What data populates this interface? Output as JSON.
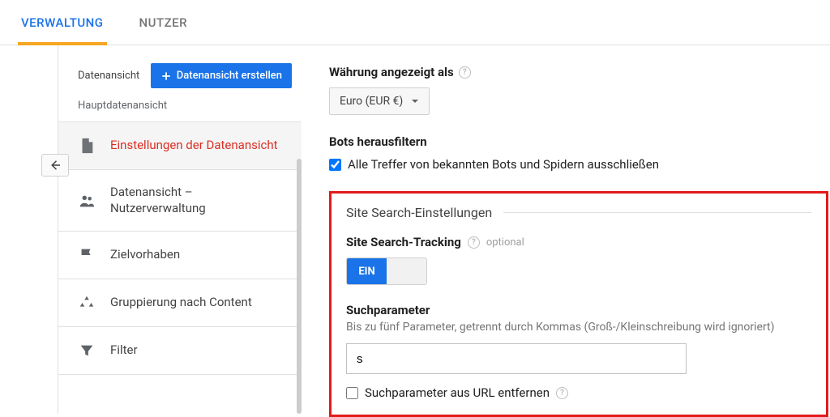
{
  "tabs": {
    "admin": "VERWALTUNG",
    "users": "NUTZER"
  },
  "sidebar": {
    "view_label": "Datenansicht",
    "create_button": "Datenansicht erstellen",
    "main_view_label": "Hauptdatenansicht",
    "items": [
      {
        "label": "Einstellungen der Datenansicht"
      },
      {
        "label": "Datenansicht – Nutzerverwaltung"
      },
      {
        "label": "Zielvorhaben"
      },
      {
        "label": "Gruppierung nach Content"
      },
      {
        "label": "Filter"
      }
    ]
  },
  "content": {
    "currency_heading": "Währung angezeigt als",
    "currency_value": "Euro (EUR €)",
    "bots_heading": "Bots herausfiltern",
    "bots_checkbox_label": "Alle Treffer von bekannten Bots und Spidern ausschließen",
    "sitesearch": {
      "fieldset_title": "Site Search-Einstellungen",
      "tracking_label": "Site Search-Tracking",
      "optional": "optional",
      "toggle_on": "EIN",
      "param_label": "Suchparameter",
      "param_hint": "Bis zu fünf Parameter, getrennt durch Kommas (Groß-/Kleinschreibung wird ignoriert)",
      "param_value": "s",
      "strip_label": "Suchparameter aus URL entfernen"
    }
  }
}
